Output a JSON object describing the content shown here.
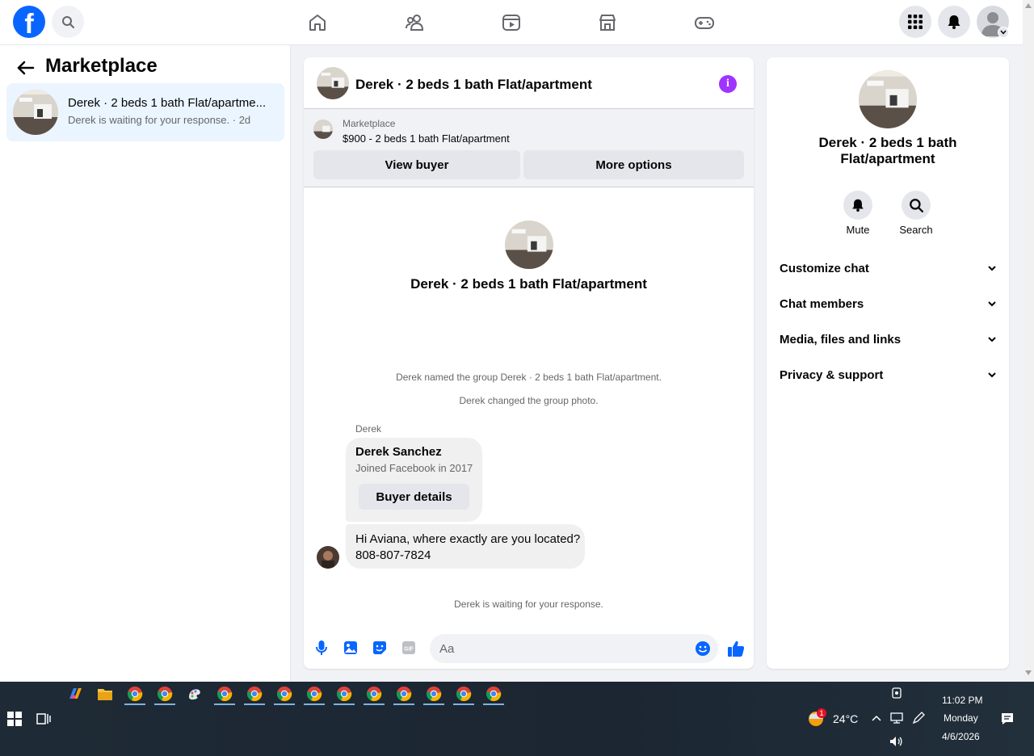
{
  "sidebar": {
    "title": "Marketplace",
    "conversations": [
      {
        "name": "Derek · 2 beds 1 bath Flat/apartme...",
        "status": "Derek is waiting for your response. · 2d"
      }
    ]
  },
  "chat": {
    "title": "Derek · 2 beds 1 bath Flat/apartment",
    "listing": {
      "label": "Marketplace",
      "title": "$900 - 2 beds 1 bath Flat/apartment",
      "view_buyer_label": "View buyer",
      "more_options_label": "More options"
    },
    "intro_title": "Derek · 2 beds 1 bath Flat/apartment",
    "system_messages": [
      "Derek named the group Derek · 2 beds 1 bath Flat/apartment.",
      "Derek changed the group photo."
    ],
    "sender": "Derek",
    "buyer_card": {
      "name": "Derek Sanchez",
      "subtitle": "Joined Facebook in 2017",
      "button_label": "Buyer details"
    },
    "message_lines": [
      "Hi Aviana, where exactly are you located?",
      "808-807-7824"
    ],
    "waiting_text": "Derek is waiting for your response.",
    "input_placeholder": "Aa"
  },
  "info_panel": {
    "title": "Derek · 2 beds 1 bath Flat/apartment",
    "actions": {
      "mute": "Mute",
      "search": "Search"
    },
    "rows": [
      "Customize chat",
      "Chat members",
      "Media, files and links",
      "Privacy & support"
    ]
  },
  "taskbar": {
    "temperature": "24°C",
    "weather_badge": "1",
    "time": "11:02 PM",
    "day": "Monday",
    "date": "4/6/2026"
  },
  "colors": {
    "brand": "#0866ff",
    "selected_bg": "#ebf5ff",
    "info_accent": "#a033ff"
  }
}
